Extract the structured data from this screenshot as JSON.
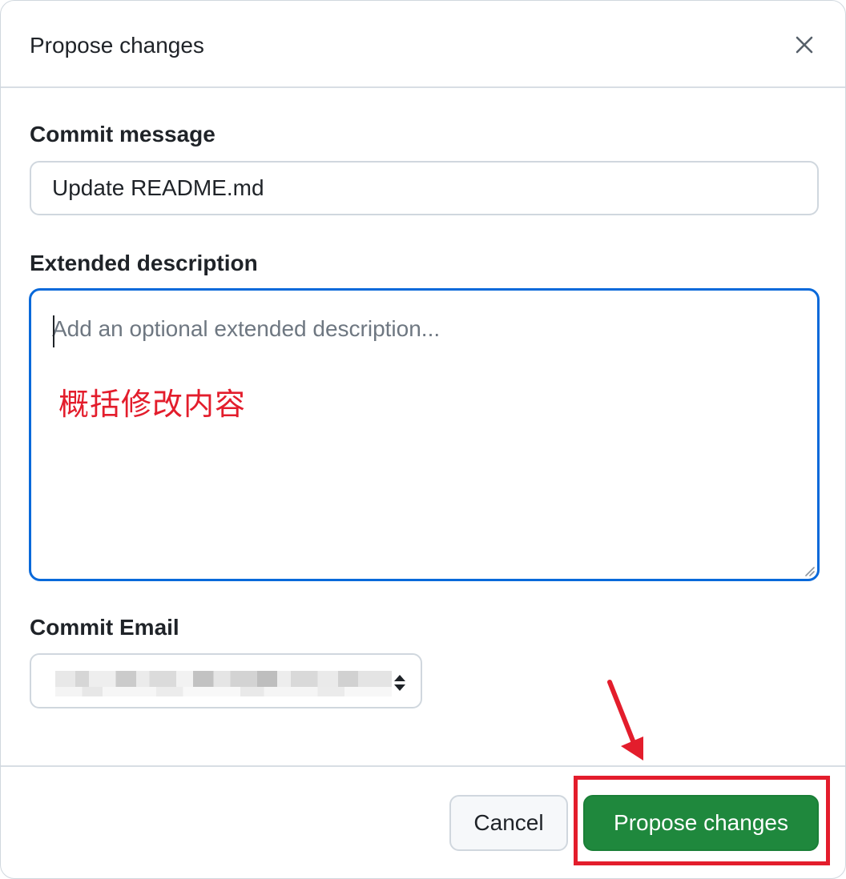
{
  "dialog": {
    "title": "Propose changes",
    "close_icon": "x-icon"
  },
  "commit_message": {
    "label": "Commit message",
    "value": "Update README.md"
  },
  "extended_description": {
    "label": "Extended description",
    "placeholder": "Add an optional extended description...",
    "annotation": "概括修改内容"
  },
  "commit_email": {
    "label": "Commit Email",
    "value_obscured": true,
    "icon": "select-arrows-icon"
  },
  "footer": {
    "cancel_label": "Cancel",
    "propose_label": "Propose changes"
  },
  "colors": {
    "primary_green": "#1f883d",
    "focus_blue": "#0969da",
    "annotation_red": "#e31d2c"
  }
}
